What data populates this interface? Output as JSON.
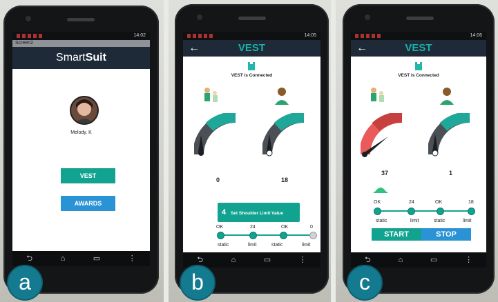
{
  "screens": {
    "a": {
      "window_title": "Screen2",
      "status_time": "14:02",
      "brand_prefix": "Smart",
      "brand_suffix": "Suit",
      "user_name": "Melody. K",
      "vest_label": "VEST",
      "awards_label": "AWARDS",
      "panel_label": "a"
    },
    "b": {
      "status_time": "14:05",
      "back_arrow": "←",
      "title": "VEST",
      "connected_text": "VEST is Connected",
      "left_value": "0",
      "right_value": "18",
      "limit_number": "4",
      "limit_button": "Set Shoulder Limit Value",
      "slider_top": [
        "OK",
        "24",
        "OK",
        "0"
      ],
      "slider_bottom": [
        "static",
        "limit",
        "static",
        "limit"
      ],
      "panel_label": "b"
    },
    "c": {
      "status_time": "14:06",
      "back_arrow": "←",
      "title": "VEST",
      "connected_text": "VEST is Connected",
      "left_value": "37",
      "right_value": "1",
      "slider_top": [
        "OK",
        "24",
        "OK",
        "18"
      ],
      "slider_bottom": [
        "static",
        "limit",
        "static",
        "limit"
      ],
      "start_label": "START",
      "stop_label": "STOP",
      "panel_label": "c"
    }
  },
  "nav_icons": [
    "back-icon",
    "home-icon",
    "recents-icon",
    "menu-icon"
  ],
  "colors": {
    "teal": "#11a38f",
    "blue": "#2a93d5",
    "dark_gray": "#4b5057",
    "red": "#ea5a5a",
    "navbar": "#1e2a38"
  }
}
